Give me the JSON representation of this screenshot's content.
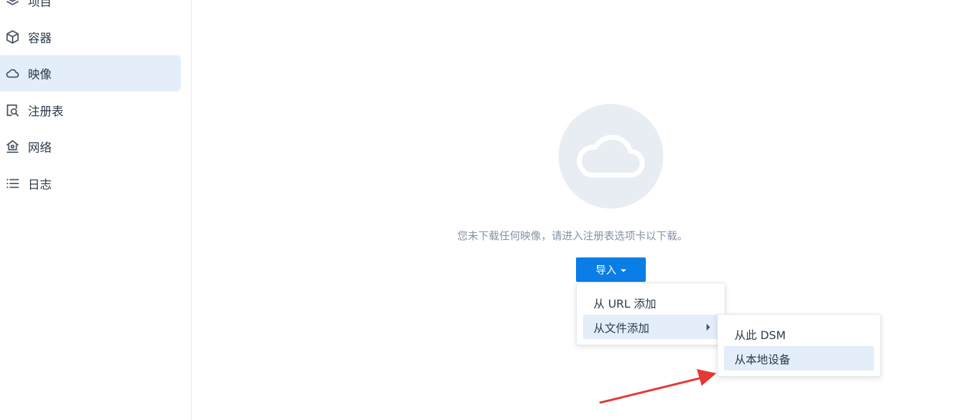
{
  "sidebar": {
    "items": [
      {
        "label": "项目",
        "icon": "layers-icon"
      },
      {
        "label": "容器",
        "icon": "cube-icon"
      },
      {
        "label": "映像",
        "icon": "cloud-icon",
        "active": true
      },
      {
        "label": "注册表",
        "icon": "registry-search-icon"
      },
      {
        "label": "网络",
        "icon": "network-house-icon"
      },
      {
        "label": "日志",
        "icon": "list-icon"
      }
    ]
  },
  "main": {
    "empty_message": "您未下载任何映像，请进入注册表选项卡以下载。",
    "import_button_label": "导入"
  },
  "import_menu": {
    "items": [
      {
        "label": "从 URL 添加"
      },
      {
        "label": "从文件添加",
        "has_submenu": true,
        "highlighted": true
      }
    ]
  },
  "file_submenu": {
    "items": [
      {
        "label": "从此 DSM"
      },
      {
        "label": "从本地设备",
        "highlighted": true
      }
    ]
  },
  "colors": {
    "accent": "#0a7ee6",
    "active_bg": "#e3eefa",
    "annotation_arrow": "#e53935"
  }
}
